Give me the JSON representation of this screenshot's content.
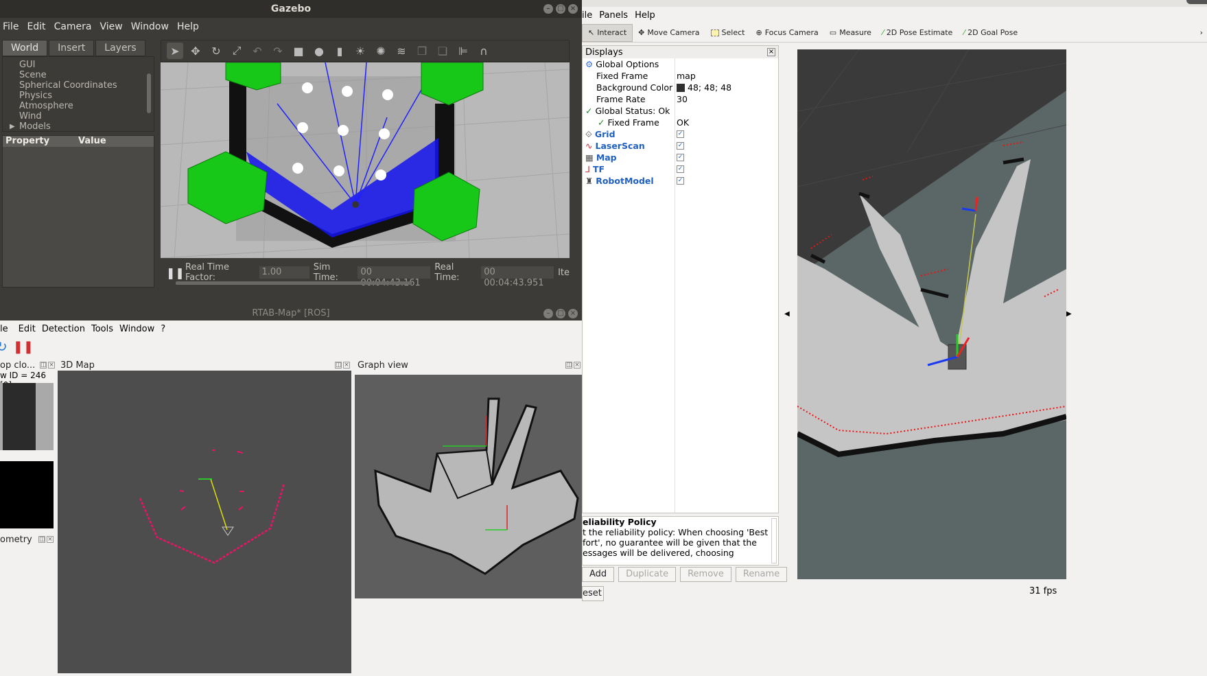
{
  "gazebo": {
    "title": "Gazebo",
    "menu": [
      "File",
      "Edit",
      "Camera",
      "View",
      "Window",
      "Help"
    ],
    "tabs": [
      "World",
      "Insert",
      "Layers"
    ],
    "tree": [
      "GUI",
      "Scene",
      "Spherical Coordinates",
      "Physics",
      "Atmosphere",
      "Wind",
      "Models"
    ],
    "prop_header": {
      "property": "Property",
      "value": "Value"
    },
    "bottom": {
      "rtf_label": "Real Time Factor:",
      "rtf_value": "1.00",
      "sim_label": "Sim Time:",
      "sim_value": "00 00:04:43.161",
      "real_label": "Real Time:",
      "real_value": "00 00:04:43.951",
      "iter_label": "Ite"
    }
  },
  "rtab": {
    "title": "RTAB-Map* [ROS]",
    "menu": [
      "le",
      "Edit",
      "Detection",
      "Tools",
      "Window",
      "?"
    ],
    "loop_title": "op clo...",
    "loop_id": "w ID = 246 [0]",
    "odometry_label": "ometry",
    "map3d_title": "3D Map",
    "graph_title": "Graph view"
  },
  "rviz": {
    "menu": [
      "ile",
      "Panels",
      "Help"
    ],
    "tools": [
      {
        "label": "Interact",
        "icon": "interact-icon"
      },
      {
        "label": "Move Camera",
        "icon": "move-camera-icon"
      },
      {
        "label": "Select",
        "icon": "select-icon"
      },
      {
        "label": "Focus Camera",
        "icon": "focus-camera-icon"
      },
      {
        "label": "Measure",
        "icon": "measure-icon"
      },
      {
        "label": "2D Pose Estimate",
        "icon": "pose-estimate-icon"
      },
      {
        "label": "2D Goal Pose",
        "icon": "goal-pose-icon"
      }
    ],
    "displays_title": "Displays",
    "displays": {
      "global_options": "Global Options",
      "fixed_frame_label": "Fixed Frame",
      "fixed_frame_value": "map",
      "bg_color_label": "Background Color",
      "bg_color_value": "48; 48; 48",
      "frame_rate_label": "Frame Rate",
      "frame_rate_value": "30",
      "global_status_label": "Global Status: Ok",
      "status_fixed_frame_label": "Fixed Frame",
      "status_fixed_frame_value": "OK",
      "grid": "Grid",
      "laserscan": "LaserScan",
      "map": "Map",
      "tf": "TF",
      "robotmodel": "RobotModel"
    },
    "desc_title": "eliability Policy",
    "desc_text": "t the reliability policy: When choosing 'Best fort', no guarantee will be given that the essages will be delivered, choosing",
    "buttons": {
      "add": "Add",
      "duplicate": "Duplicate",
      "remove": "Remove",
      "rename": "Rename"
    },
    "reset_label": "eset",
    "fps": "31 fps"
  },
  "colors": {
    "bg_dark": "#3c3b37",
    "rviz_bg": "#303030",
    "laser_blue": "#1010ee",
    "scan_red": "#ee1111"
  }
}
